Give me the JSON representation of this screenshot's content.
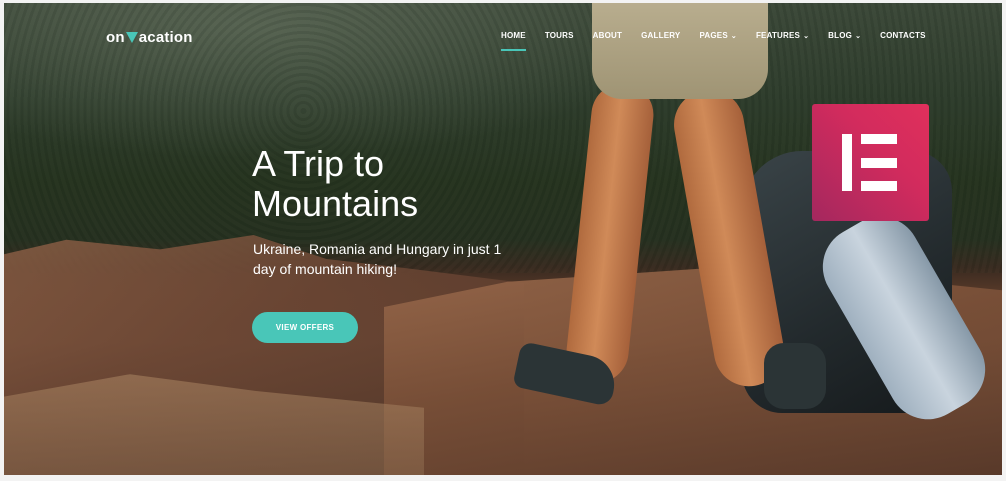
{
  "brand": {
    "logo_pre": "on",
    "logo_post": "acation"
  },
  "nav": {
    "items": [
      {
        "label": "HOME",
        "active": true,
        "dropdown": false
      },
      {
        "label": "TOURS",
        "active": false,
        "dropdown": false
      },
      {
        "label": "ABOUT",
        "active": false,
        "dropdown": false
      },
      {
        "label": "GALLERY",
        "active": false,
        "dropdown": false
      },
      {
        "label": "PAGES",
        "active": false,
        "dropdown": true
      },
      {
        "label": "FEATURES",
        "active": false,
        "dropdown": true
      },
      {
        "label": "BLOG",
        "active": false,
        "dropdown": true
      },
      {
        "label": "CONTACTS",
        "active": false,
        "dropdown": false
      }
    ],
    "caret": "⌄"
  },
  "hero": {
    "title_line1": "A Trip to",
    "title_line2": "Mountains",
    "subtitle": "Ukraine, Romania and Hungary in just 1 day of mountain hiking!",
    "cta_label": "VIEW OFFERS"
  },
  "badge": {
    "icon": "elementor-icon"
  },
  "colors": {
    "accent": "#49c6b8",
    "badge": "#d22b5d",
    "text": "#ffffff"
  }
}
